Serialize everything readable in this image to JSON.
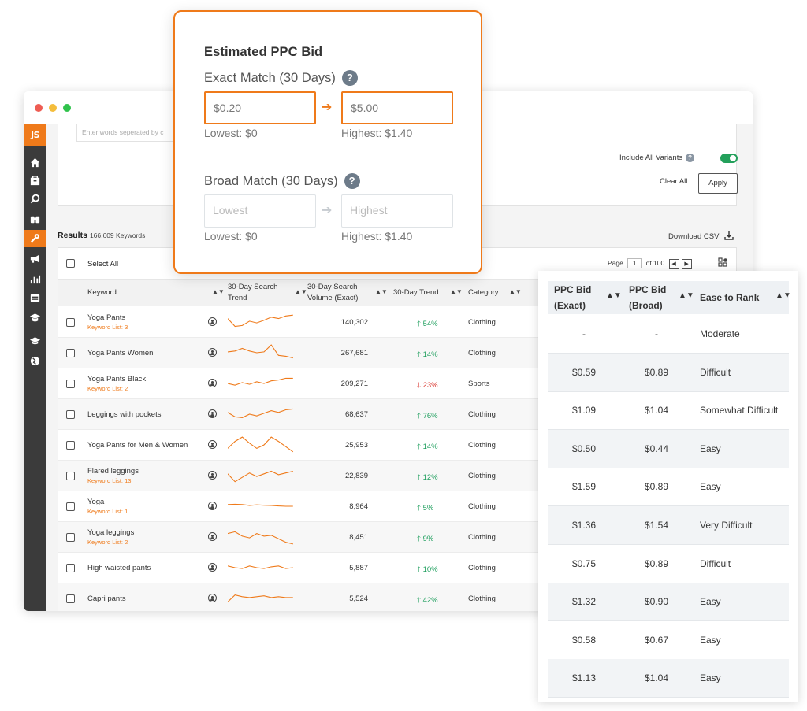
{
  "window": {
    "logo": "JS"
  },
  "filters": {
    "keyword_placeholder": "Enter words seperated by c",
    "include_variants_label": "Include All Variants",
    "help_glyph": "?",
    "clear_all_label": "Clear All",
    "apply_label": "Apply"
  },
  "results": {
    "label": "Results",
    "count": "166,609 Keywords",
    "download_label": "Download CSV",
    "select_all_label": "Select All",
    "page_label": "Page",
    "page_value": "1",
    "page_total": "of 100"
  },
  "table": {
    "headers": {
      "keyword": "Keyword",
      "trend_chart": "30-Day Search Trend",
      "volume": "30-Day Search Volume (Exact)",
      "trend": "30-Day Trend",
      "category": "Category"
    },
    "rows": [
      {
        "keyword": "Yoga Pants",
        "list": "Keyword List: 3",
        "volume": "140,302",
        "trend": "54%",
        "dir": "up",
        "category": "Clothing",
        "spark": [
          0.7,
          0.25,
          0.3,
          0.55,
          0.45,
          0.6,
          0.78,
          0.7,
          0.85,
          0.9
        ]
      },
      {
        "keyword": "Yoga Pants Women",
        "list": "",
        "volume": "267,681",
        "trend": "14%",
        "dir": "up",
        "category": "Clothing",
        "spark": [
          0.55,
          0.6,
          0.75,
          0.6,
          0.5,
          0.55,
          0.95,
          0.35,
          0.3,
          0.2
        ]
      },
      {
        "keyword": "Yoga Pants Black",
        "list": "Keyword List: 2",
        "volume": "209,271",
        "trend": "23%",
        "dir": "down",
        "category": "Sports",
        "spark": [
          0.5,
          0.4,
          0.55,
          0.45,
          0.6,
          0.5,
          0.65,
          0.7,
          0.8,
          0.8
        ]
      },
      {
        "keyword": "Leggings with pockets",
        "list": "",
        "volume": "68,637",
        "trend": "76%",
        "dir": "up",
        "category": "Clothing",
        "spark": [
          0.6,
          0.35,
          0.3,
          0.5,
          0.4,
          0.55,
          0.7,
          0.6,
          0.75,
          0.8
        ]
      },
      {
        "keyword": "Yoga Pants for Men & Women",
        "list": "",
        "volume": "25,953",
        "trend": "14%",
        "dir": "up",
        "category": "Clothing",
        "spark": [
          0.3,
          0.7,
          0.95,
          0.6,
          0.3,
          0.5,
          0.95,
          0.7,
          0.4,
          0.1
        ]
      },
      {
        "keyword": "Flared leggings",
        "list": "Keyword List: 13",
        "volume": "22,839",
        "trend": "12%",
        "dir": "up",
        "category": "Clothing",
        "spark": [
          0.6,
          0.15,
          0.4,
          0.65,
          0.45,
          0.6,
          0.75,
          0.55,
          0.65,
          0.75
        ]
      },
      {
        "keyword": "Yoga",
        "list": "Keyword List: 1",
        "volume": "8,964",
        "trend": "5%",
        "dir": "up",
        "category": "Clothing",
        "spark": [
          0.6,
          0.62,
          0.6,
          0.55,
          0.58,
          0.56,
          0.55,
          0.52,
          0.5,
          0.5
        ]
      },
      {
        "keyword": "Yoga leggings",
        "list": "Keyword List: 2",
        "volume": "8,451",
        "trend": "9%",
        "dir": "up",
        "category": "Clothing",
        "spark": [
          0.7,
          0.8,
          0.55,
          0.45,
          0.7,
          0.55,
          0.6,
          0.4,
          0.2,
          0.1
        ]
      },
      {
        "keyword": "High waisted pants",
        "list": "",
        "volume": "5,887",
        "trend": "10%",
        "dir": "up",
        "category": "Clothing",
        "spark": [
          0.6,
          0.5,
          0.45,
          0.6,
          0.5,
          0.45,
          0.55,
          0.6,
          0.45,
          0.5
        ]
      },
      {
        "keyword": "Capri pants",
        "list": "",
        "volume": "5,524",
        "trend": "42%",
        "dir": "up",
        "category": "Clothing",
        "spark": [
          0.3,
          0.7,
          0.6,
          0.55,
          0.6,
          0.65,
          0.55,
          0.6,
          0.55,
          0.55
        ]
      }
    ]
  },
  "ppc": {
    "title": "Estimated PPC Bid",
    "exact_label": "Exact Match (30 Days)",
    "exact_low_value": "$0.20",
    "exact_high_value": "$5.00",
    "exact_low_note": "Lowest: $0",
    "exact_high_note": "Highest: $1.40",
    "broad_label": "Broad Match (30 Days)",
    "broad_low_placeholder": "Lowest",
    "broad_high_placeholder": "Highest",
    "broad_low_note": "Lowest: $0",
    "broad_high_note": "Highest: $1.40",
    "help_glyph": "?"
  },
  "overlay": {
    "headers": {
      "exact": "PPC Bid (Exact)",
      "broad": "PPC Bid (Broad)",
      "ease": "Ease to Rank"
    },
    "rows": [
      {
        "exact": "-",
        "broad": "-",
        "ease": "Moderate"
      },
      {
        "exact": "$0.59",
        "broad": "$0.89",
        "ease": "Difficult"
      },
      {
        "exact": "$1.09",
        "broad": "$1.04",
        "ease": "Somewhat Difficult"
      },
      {
        "exact": "$0.50",
        "broad": "$0.44",
        "ease": "Easy"
      },
      {
        "exact": "$1.59",
        "broad": "$0.89",
        "ease": "Easy"
      },
      {
        "exact": "$1.36",
        "broad": "$1.54",
        "ease": "Very Difficult"
      },
      {
        "exact": "$0.75",
        "broad": "$0.89",
        "ease": "Difficult"
      },
      {
        "exact": "$1.32",
        "broad": "$0.90",
        "ease": "Easy"
      },
      {
        "exact": "$0.58",
        "broad": "$0.67",
        "ease": "Easy"
      },
      {
        "exact": "$1.13",
        "broad": "$1.04",
        "ease": "Easy"
      }
    ]
  },
  "colors": {
    "accent": "#ef7a1a",
    "up": "#1f9f5e",
    "down": "#d9322a",
    "sidebar": "#3b3b3b"
  }
}
